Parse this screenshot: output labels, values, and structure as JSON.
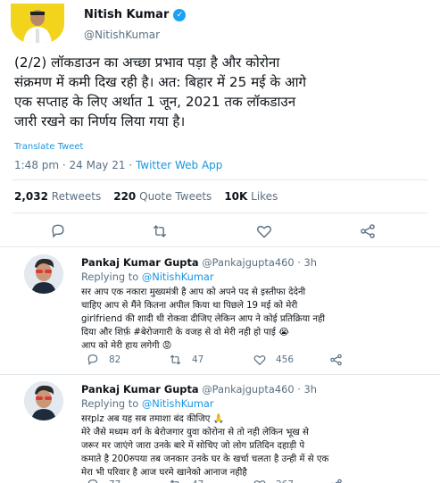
{
  "tweet": {
    "author_name": "Nitish Kumar",
    "author_handle": "@NitishKumar",
    "text_lines": [
      "(2/2) लॉकडाउन का अच्छा प्रभाव पड़ा है और कोरोना",
      "संक्रमण में कमी दिख रही है। अत: बिहार में 25 मई के आगे",
      "एक सप्ताह के लिए अर्थात 1 जून, 2021 तक लॉकडाउन",
      "जारी रखने का निर्णय लिया गया है।"
    ],
    "translate_label": "Translate Tweet",
    "time": "1:48 pm · 24 May 21 · ",
    "source": "Twitter Web App",
    "stats": {
      "retweets_count": "2,032",
      "retweets_label": "Retweets",
      "quotes_count": "220",
      "quotes_label": "Quote Tweets",
      "likes_count": "10K",
      "likes_label": "Likes"
    }
  },
  "replies": [
    {
      "name": "Pankaj Kumar Gupta",
      "handle": "@Pankajgupta460",
      "time": "· 3h",
      "replying_label": "Replying to ",
      "replying_to": "@NitishKumar",
      "text_lines": [
        "सर आप एक नकारा मुख्यमंत्री है आप को अपने पद से इस्तीफा देदेनी",
        "चाहिए आप से मैंने कितना अपील किया था पिछले 19 मई को मेरी",
        "girlfriend की शादी थी रोकवा दीजिए लेकिन आप ने कोई प्रतिक्रिया नही",
        "दिया और शिर्फ़ #बेरोजगारी के वजह से वो मेरी नही हो पाई 😭",
        "आप को मेरी हाय लगेगी 😡"
      ],
      "replies_count": "82",
      "retweets_count": "47",
      "likes_count": "456"
    },
    {
      "name": "Pankaj Kumar Gupta",
      "handle": "@Pankajgupta460",
      "time": "· 3h",
      "replying_label": "Replying to ",
      "replying_to": "@NitishKumar",
      "text_lines": [
        "सरplz अब यह सब तमाशा बंद कीजिए 🙏",
        "मेरे जैसे मध्यम वर्ग के बेरोजगार युवा कोरोना से तो नही लेकिन भूख से",
        "जरूर मर जाएंगे जारा उनके बारे में सोचिए जो लोग प्रतिदिन दहाड़ी पे",
        "कमाते है 200रुपया तब जनकार उनके घर के खर्चा चलता है उन्ही में से एक",
        "मेरा भी परिवार है आज घरमे खानेको आनाज नहीहै"
      ],
      "replies_count": "77",
      "retweets_count": "47",
      "likes_count": "267"
    }
  ],
  "icons": [
    "reply-icon",
    "retweet-icon",
    "like-icon",
    "share-icon",
    "verified-icon"
  ],
  "colors": {
    "link": "#1b95e0",
    "muted": "#5b7083",
    "divider": "#e1e8ed",
    "text": "#0f1419"
  }
}
